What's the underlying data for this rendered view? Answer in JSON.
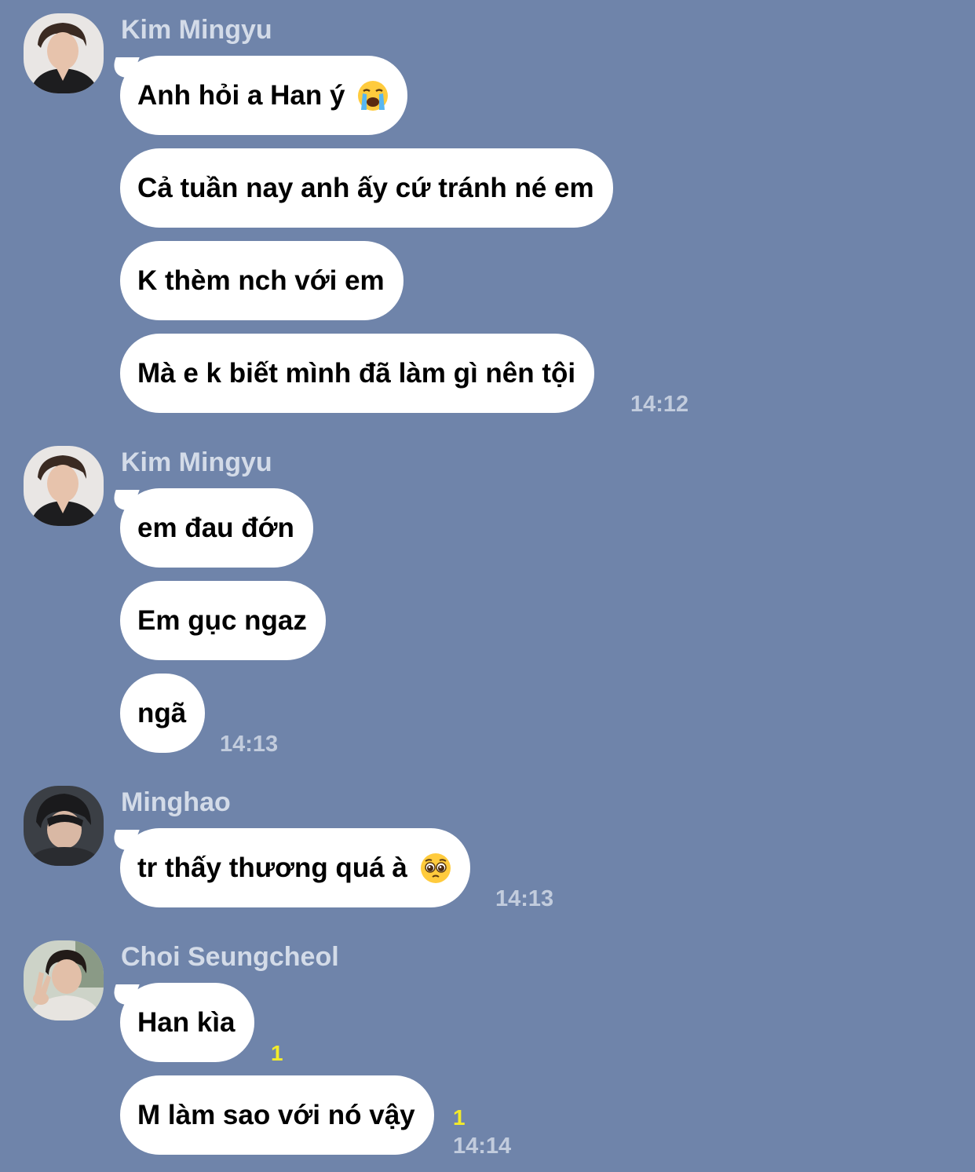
{
  "chat": {
    "groups": [
      {
        "sender": "Kim Mingyu",
        "avatar_icon": "avatar-mingyu",
        "messages": [
          {
            "text": "Anh hỏi a Han ý",
            "emoji": "loudly-crying-face-icon"
          },
          {
            "text": "Cả tuần nay anh ấy cứ tránh né em"
          },
          {
            "text": "K thèm nch với em"
          },
          {
            "text": "Mà e k biết mình đã làm gì nên tội"
          }
        ],
        "time": "14:12"
      },
      {
        "sender": "Kim Mingyu",
        "avatar_icon": "avatar-mingyu",
        "messages": [
          {
            "text": "em đau đớn"
          },
          {
            "text": "Em gục ngaz"
          },
          {
            "text": "ngã"
          }
        ],
        "time": "14:13"
      },
      {
        "sender": "Minghao",
        "avatar_icon": "avatar-minghao",
        "messages": [
          {
            "text": "tr thấy thương quá à",
            "emoji": "pleading-face-icon"
          }
        ],
        "time": "14:13"
      },
      {
        "sender": "Choi Seungcheol",
        "avatar_icon": "avatar-seungcheol",
        "messages": [
          {
            "text": "Han kìa",
            "unread": "1"
          },
          {
            "text": "M làm sao với nó vậy",
            "unread": "1"
          }
        ],
        "time": "14:14"
      }
    ]
  },
  "colors": {
    "background": "#6f84aa",
    "bubble": "#ffffff",
    "sender_name": "#d3dbe8",
    "timestamp": "#c2ccdd",
    "unread_count": "#f3eb2a"
  }
}
